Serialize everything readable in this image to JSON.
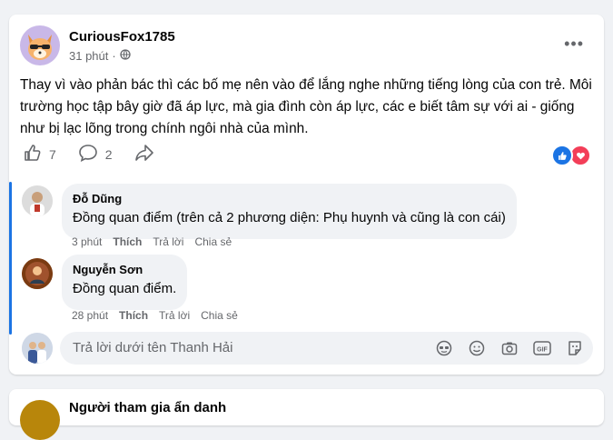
{
  "post": {
    "author": "CuriousFox1785",
    "time": "31 phút",
    "audience_icon": "globe-icon",
    "text": "Thay vì vào phản bác thì các bố mẹ nên vào để lắng nghe những tiếng lòng của con trẻ. Môi trường học tập bây giờ đã áp lực, mà gia đình còn áp lực, các e biết tâm sự với ai - giống như bị lạc lõng trong chính ngôi nhà của mình.",
    "like_count": "7",
    "comment_count": "2",
    "reactions": [
      "like-icon",
      "love-icon"
    ]
  },
  "comments": [
    {
      "author": "Đỗ Dũng",
      "text": "Đồng quan điểm (trên cả 2 phương diện: Phụ huynh và cũng là con cái)",
      "time": "3 phút",
      "like_label": "Thích",
      "reply_label": "Trả lời",
      "share_label": "Chia sẻ"
    },
    {
      "author": "Nguyễn Sơn",
      "text": "Đồng quan điểm.",
      "time": "28 phút",
      "like_label": "Thích",
      "reply_label": "Trả lời",
      "share_label": "Chia sẻ"
    }
  ],
  "reply": {
    "placeholder": "Trả lời dưới tên Thanh Hải",
    "icons": [
      "avatar-sticker-icon",
      "emoji-icon",
      "camera-icon",
      "gif-icon",
      "sticker-icon"
    ]
  },
  "next_post": {
    "author": "Người tham gia ẩn danh"
  },
  "colors": {
    "accent": "#1b74e4",
    "love": "#f33e58",
    "background": "#f0f2f5"
  }
}
